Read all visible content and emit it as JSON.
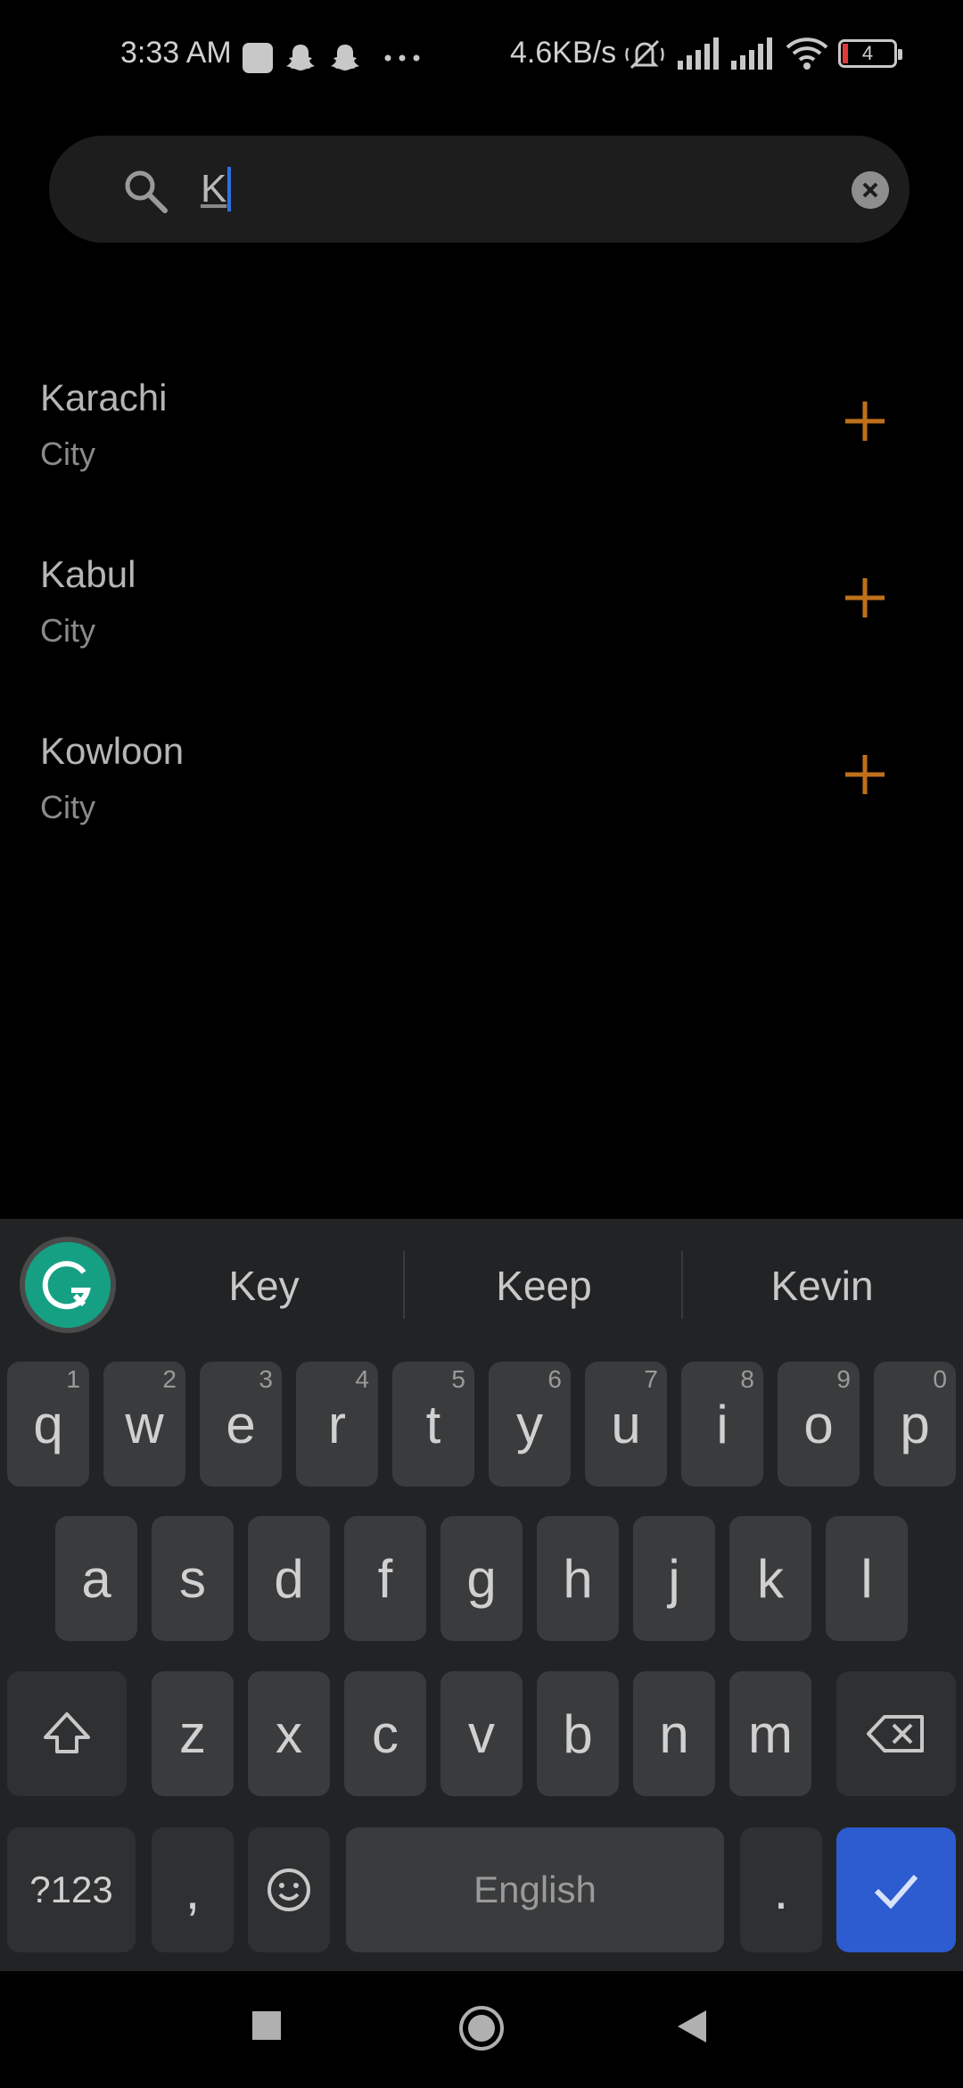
{
  "status_bar": {
    "time": "3:33 AM",
    "net_speed": "4.6KB/s",
    "battery_level": "4",
    "icons": [
      "app-notification-icon",
      "snapchat-icon",
      "snapchat-icon",
      "more-dots-icon",
      "silent-icon",
      "signal-icon",
      "signal-icon",
      "wifi-icon",
      "battery-icon"
    ]
  },
  "search": {
    "query": "K",
    "icon": "search-icon",
    "clear_icon": "clear-icon"
  },
  "results": [
    {
      "name": "Karachi",
      "type": "City"
    },
    {
      "name": "Kabul",
      "type": "City"
    },
    {
      "name": "Kowloon",
      "type": "City"
    }
  ],
  "accent_color": "#c0701a",
  "keyboard": {
    "suggestions": [
      "Key",
      "Keep",
      "Kevin"
    ],
    "row1": [
      {
        "key": "q",
        "hint": "1"
      },
      {
        "key": "w",
        "hint": "2"
      },
      {
        "key": "e",
        "hint": "3"
      },
      {
        "key": "r",
        "hint": "4"
      },
      {
        "key": "t",
        "hint": "5"
      },
      {
        "key": "y",
        "hint": "6"
      },
      {
        "key": "u",
        "hint": "7"
      },
      {
        "key": "i",
        "hint": "8"
      },
      {
        "key": "o",
        "hint": "9"
      },
      {
        "key": "p",
        "hint": "0"
      }
    ],
    "row2": [
      "a",
      "s",
      "d",
      "f",
      "g",
      "h",
      "j",
      "k",
      "l"
    ],
    "row3": [
      "z",
      "x",
      "c",
      "v",
      "b",
      "n",
      "m"
    ],
    "symbols_label": "?123",
    "comma": ",",
    "space_label": "English",
    "period": "."
  }
}
